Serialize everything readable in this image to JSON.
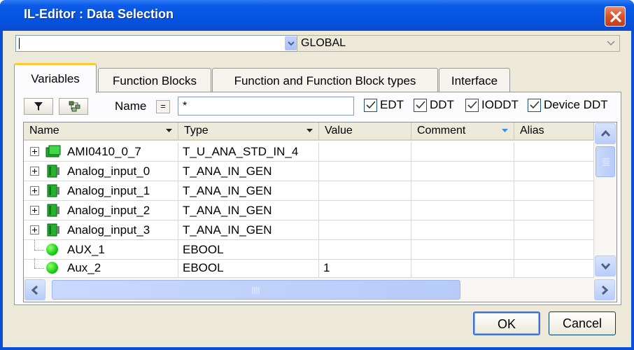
{
  "window": {
    "title": "IL-Editor : Data Selection"
  },
  "combos": {
    "left_value": "",
    "right_value": "GLOBAL"
  },
  "tabs": [
    {
      "label": "Variables",
      "active": true
    },
    {
      "label": "Function Blocks",
      "active": false
    },
    {
      "label": "Function and Function Block types",
      "active": false
    },
    {
      "label": "Interface",
      "active": false
    }
  ],
  "filter": {
    "name_label": "Name",
    "eq_label": "=",
    "name_value": "*",
    "checks": [
      {
        "label": "EDT",
        "checked": true
      },
      {
        "label": "DDT",
        "checked": true
      },
      {
        "label": "IODDT",
        "checked": true
      },
      {
        "label": "Device DDT",
        "checked": true
      }
    ]
  },
  "columns": [
    "Name",
    "Type",
    "Value",
    "Comment",
    "Alias"
  ],
  "rows": [
    {
      "name": "AMI0410_0_7",
      "type": "T_U_ANA_STD_IN_4",
      "value": "",
      "comment": "",
      "alias": "",
      "icon": "device-icon"
    },
    {
      "name": "Analog_input_0",
      "type": "T_ANA_IN_GEN",
      "value": "",
      "comment": "",
      "alias": "",
      "icon": "module-icon"
    },
    {
      "name": "Analog_input_1",
      "type": "T_ANA_IN_GEN",
      "value": "",
      "comment": "",
      "alias": "",
      "icon": "module-icon"
    },
    {
      "name": "Analog_input_2",
      "type": "T_ANA_IN_GEN",
      "value": "",
      "comment": "",
      "alias": "",
      "icon": "module-icon"
    },
    {
      "name": "Analog_input_3",
      "type": "T_ANA_IN_GEN",
      "value": "",
      "comment": "",
      "alias": "",
      "icon": "module-icon"
    },
    {
      "name": "AUX_1",
      "type": "EBOOL",
      "value": "",
      "comment": "",
      "alias": "",
      "icon": "bool-variable-icon"
    },
    {
      "name": "Aux_2",
      "type": "EBOOL",
      "value": "1",
      "comment": "",
      "alias": "",
      "icon": "bool-variable-icon"
    }
  ],
  "buttons": {
    "ok": "OK",
    "cancel": "Cancel"
  },
  "colors": {
    "titlebar": "#0653e0",
    "dialog_bg": "#ece9d8",
    "tab_highlight": "#ffc83c",
    "close_button": "#d9512a"
  }
}
